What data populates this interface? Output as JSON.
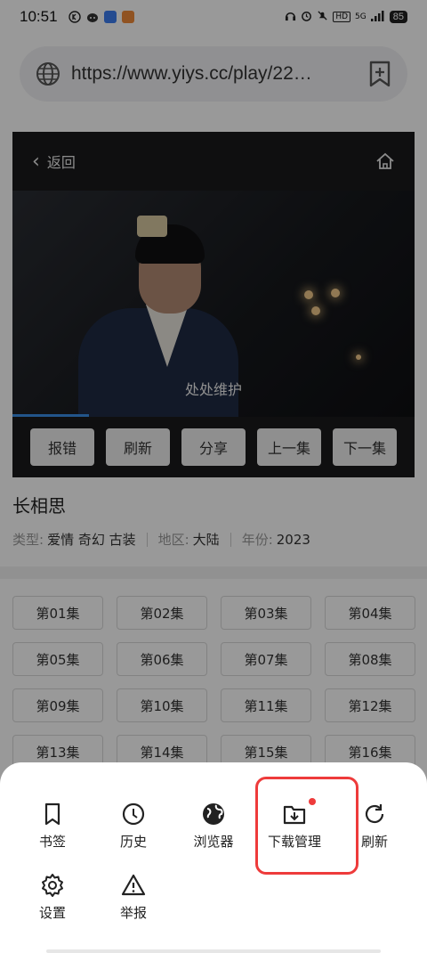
{
  "status_bar": {
    "time": "10:51",
    "battery": "85",
    "network": "5G",
    "hd": "HD"
  },
  "url_bar": {
    "url": "https://www.yiys.cc/play/22…"
  },
  "player": {
    "back_label": "返回",
    "subtitle": "处处维护",
    "progress": 0.19,
    "actions": [
      "报错",
      "刷新",
      "分享",
      "上一集",
      "下一集"
    ]
  },
  "show": {
    "title": "长相思",
    "type_label": "类型:",
    "genres": "爱情 奇幻 古装",
    "region_label": "地区:",
    "region": "大陆",
    "year_label": "年份:",
    "year": "2023"
  },
  "episodes": [
    "第01集",
    "第02集",
    "第03集",
    "第04集",
    "第05集",
    "第06集",
    "第07集",
    "第08集",
    "第09集",
    "第10集",
    "第11集",
    "第12集",
    "第13集",
    "第14集",
    "第15集",
    "第16集"
  ],
  "menu": {
    "bookmarks": "书签",
    "history": "历史",
    "browser": "浏览器",
    "downloads": "下载管理",
    "refresh": "刷新",
    "settings": "设置",
    "report": "举报"
  },
  "colors": {
    "highlight": "#ee3b3b",
    "accent": "#3a8ee6"
  }
}
